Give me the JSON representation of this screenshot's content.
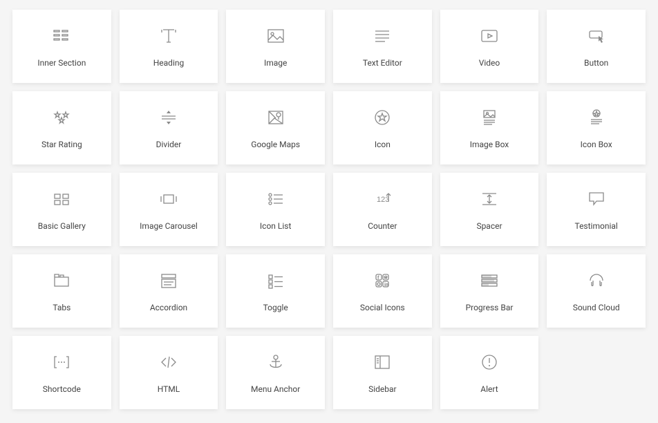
{
  "widgets": [
    {
      "id": "inner-section",
      "label": "Inner Section",
      "icon": "inner-section-icon"
    },
    {
      "id": "heading",
      "label": "Heading",
      "icon": "heading-icon"
    },
    {
      "id": "image",
      "label": "Image",
      "icon": "image-icon"
    },
    {
      "id": "text-editor",
      "label": "Text Editor",
      "icon": "text-editor-icon"
    },
    {
      "id": "video",
      "label": "Video",
      "icon": "video-icon"
    },
    {
      "id": "button",
      "label": "Button",
      "icon": "button-icon"
    },
    {
      "id": "star-rating",
      "label": "Star Rating",
      "icon": "star-rating-icon"
    },
    {
      "id": "divider",
      "label": "Divider",
      "icon": "divider-icon"
    },
    {
      "id": "google-maps",
      "label": "Google Maps",
      "icon": "google-maps-icon"
    },
    {
      "id": "icon",
      "label": "Icon",
      "icon": "icon-icon"
    },
    {
      "id": "image-box",
      "label": "Image Box",
      "icon": "image-box-icon"
    },
    {
      "id": "icon-box",
      "label": "Icon Box",
      "icon": "icon-box-icon"
    },
    {
      "id": "basic-gallery",
      "label": "Basic Gallery",
      "icon": "basic-gallery-icon"
    },
    {
      "id": "image-carousel",
      "label": "Image Carousel",
      "icon": "image-carousel-icon"
    },
    {
      "id": "icon-list",
      "label": "Icon List",
      "icon": "icon-list-icon"
    },
    {
      "id": "counter",
      "label": "Counter",
      "icon": "counter-icon"
    },
    {
      "id": "spacer",
      "label": "Spacer",
      "icon": "spacer-icon"
    },
    {
      "id": "testimonial",
      "label": "Testimonial",
      "icon": "testimonial-icon"
    },
    {
      "id": "tabs",
      "label": "Tabs",
      "icon": "tabs-icon"
    },
    {
      "id": "accordion",
      "label": "Accordion",
      "icon": "accordion-icon"
    },
    {
      "id": "toggle",
      "label": "Toggle",
      "icon": "toggle-icon"
    },
    {
      "id": "social-icons",
      "label": "Social Icons",
      "icon": "social-icons-icon"
    },
    {
      "id": "progress-bar",
      "label": "Progress Bar",
      "icon": "progress-bar-icon"
    },
    {
      "id": "sound-cloud",
      "label": "Sound Cloud",
      "icon": "sound-cloud-icon"
    },
    {
      "id": "shortcode",
      "label": "Shortcode",
      "icon": "shortcode-icon"
    },
    {
      "id": "html",
      "label": "HTML",
      "icon": "html-icon"
    },
    {
      "id": "menu-anchor",
      "label": "Menu Anchor",
      "icon": "menu-anchor-icon"
    },
    {
      "id": "sidebar",
      "label": "Sidebar",
      "icon": "sidebar-icon"
    },
    {
      "id": "alert",
      "label": "Alert",
      "icon": "alert-icon"
    }
  ]
}
